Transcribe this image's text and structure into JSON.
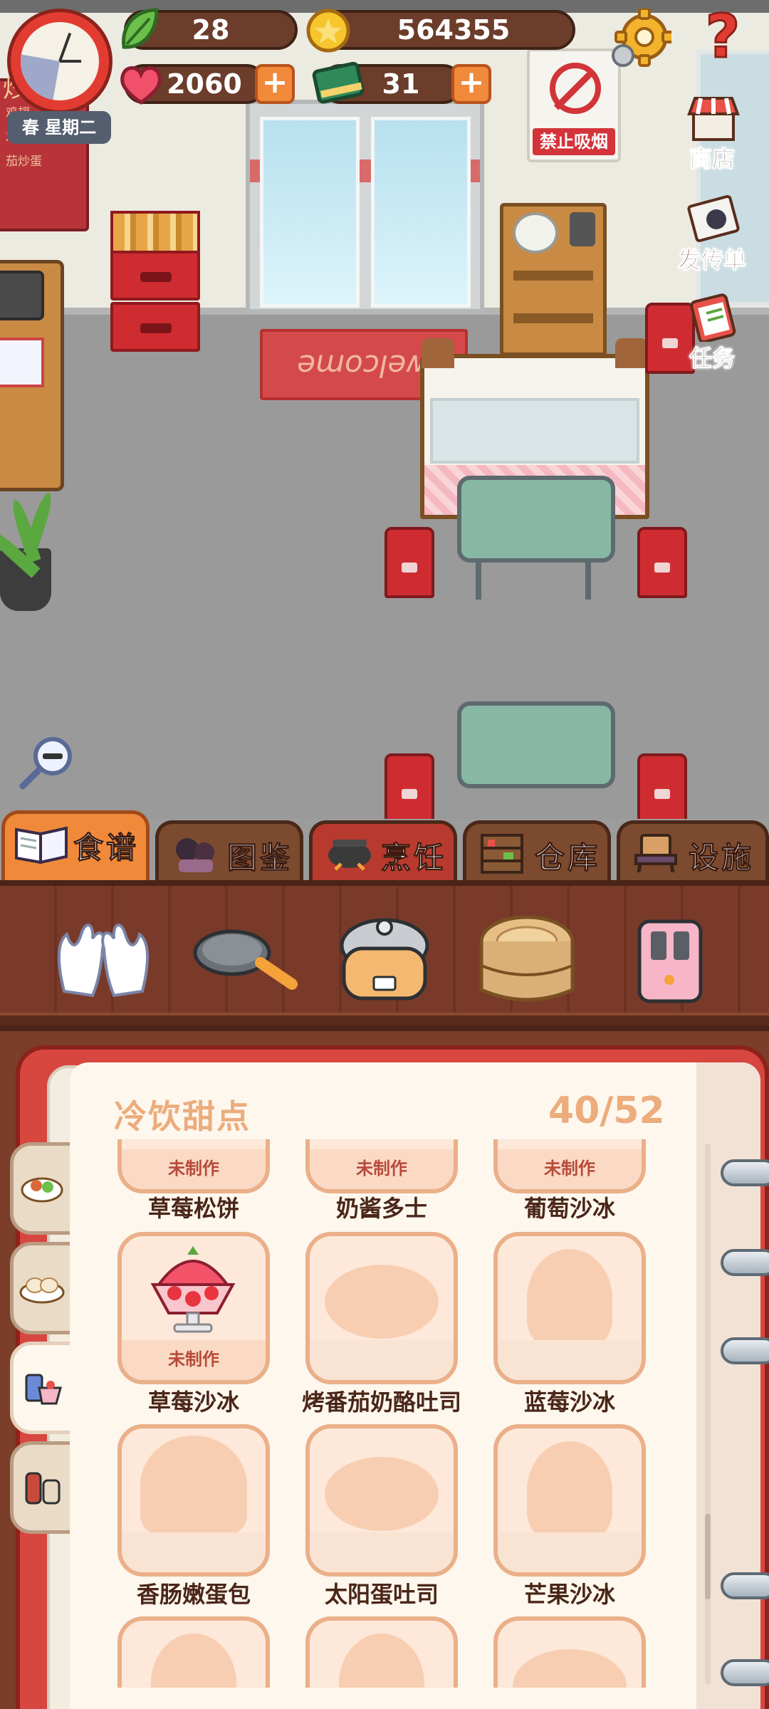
{
  "hud": {
    "season_day": "春 星期二",
    "leaf_count": "28",
    "coins": "564355",
    "hearts": "2060",
    "books": "31",
    "plus_label": "+",
    "help_label": "?"
  },
  "scene": {
    "no_smoking_sign": "禁止吸烟",
    "doormat_text": "welcome",
    "menu_board_header": "炒",
    "menu_board_items": [
      "鸡翅",
      "鸡爪",
      "茄炒蛋"
    ]
  },
  "side_buttons": {
    "shop": "商店",
    "flyers": "发传单",
    "tasks": "任务"
  },
  "tabs": [
    {
      "label": "食谱",
      "icon": "recipe-book-icon",
      "active": true
    },
    {
      "label": "图鉴",
      "icon": "characters-icon",
      "active": false
    },
    {
      "label": "烹饪",
      "icon": "cooking-pot-icon",
      "active": false
    },
    {
      "label": "仓库",
      "icon": "storage-shelf-icon",
      "active": false
    },
    {
      "label": "设施",
      "icon": "facility-chair-icon",
      "active": false
    }
  ],
  "tools": [
    {
      "name": "gloves",
      "icon": "gloves-icon"
    },
    {
      "name": "frying-pan",
      "icon": "frying-pan-icon"
    },
    {
      "name": "rice-cooker",
      "icon": "rice-cooker-icon"
    },
    {
      "name": "steamer",
      "icon": "steamer-basket-icon"
    },
    {
      "name": "toaster",
      "icon": "toaster-icon"
    }
  ],
  "recipe_book": {
    "category_title": "冷饮甜点",
    "progress": "40/52",
    "unmade_label": "未制作",
    "side_tabs": [
      "main-dishes-icon",
      "dumplings-icon",
      "dessert-drink-icon",
      "sauce-bottles-icon"
    ],
    "rows": [
      [
        "草莓松饼",
        "奶酱多士",
        "葡萄沙冰"
      ],
      [
        "草莓沙冰",
        "烤番茄奶酪吐司",
        "蓝莓沙冰"
      ],
      [
        "香肠嫩蛋包",
        "太阳蛋吐司",
        "芒果沙冰"
      ],
      [
        "",
        "",
        ""
      ]
    ]
  },
  "colors": {
    "accent_orange": "#f08a3a",
    "brand_red": "#e23c32",
    "wood_brown": "#6b3d2a",
    "page_cream": "#fdf7ee",
    "card_peach": "#fde8d9"
  }
}
